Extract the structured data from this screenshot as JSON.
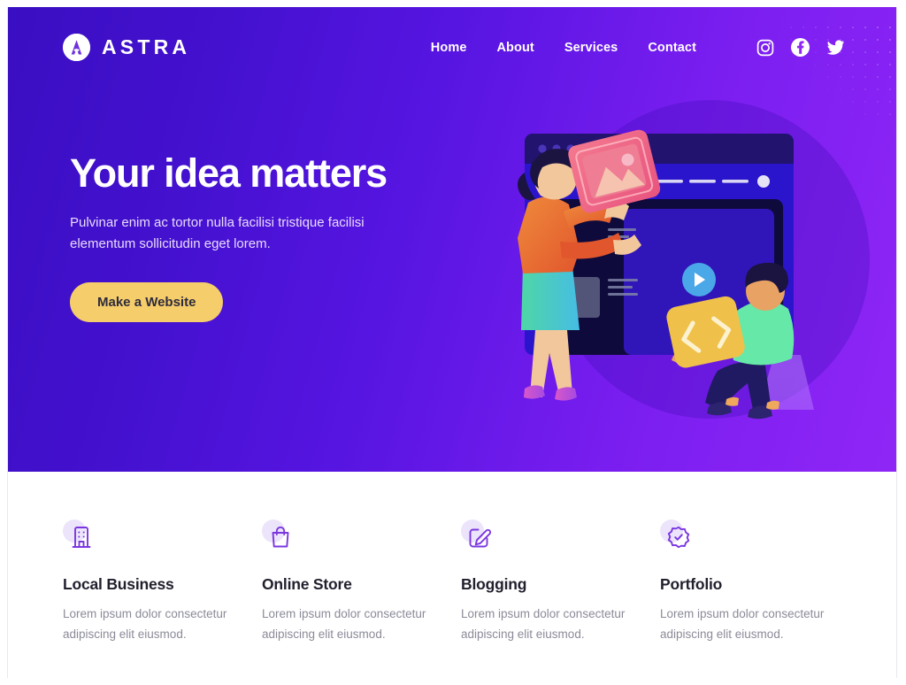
{
  "brand": {
    "name": "ASTRA",
    "logo_icon": "astra-a-mark-icon"
  },
  "header": {
    "nav": [
      {
        "label": "Home",
        "name": "nav-link-home"
      },
      {
        "label": "About",
        "name": "nav-link-about"
      },
      {
        "label": "Services",
        "name": "nav-link-services"
      },
      {
        "label": "Contact",
        "name": "nav-link-contact"
      }
    ],
    "social": [
      {
        "label": "Instagram",
        "icon": "instagram-icon"
      },
      {
        "label": "Facebook",
        "icon": "facebook-icon"
      },
      {
        "label": "Twitter",
        "icon": "twitter-icon"
      }
    ]
  },
  "hero": {
    "title": "Your idea matters",
    "subtitle": "Pulvinar enim ac tortor nulla facilisi tristique facilisi elementum sollicitudin eget lorem.",
    "cta_label": "Make a Website",
    "cta_color": "#f5cd6a",
    "gradient_from": "#3a0ec2",
    "gradient_to": "#8f26f6",
    "illustration": {
      "name": "website-builder-illustration",
      "browser_dots": 3,
      "play_button_color": "#4ba8e8",
      "pill_color": "#3fd9a0",
      "card_pink_color": "#f2608b",
      "card_yellow_color": "#efc14a",
      "code_symbol": "</>"
    }
  },
  "features": [
    {
      "title": "Local Business",
      "text": "Lorem ipsum dolor consectetur adipiscing elit eiusmod.",
      "icon": "building-icon"
    },
    {
      "title": "Online Store",
      "text": "Lorem ipsum dolor consectetur adipiscing elit eiusmod.",
      "icon": "shopping-bag-icon"
    },
    {
      "title": "Blogging",
      "text": "Lorem ipsum dolor consectetur adipiscing elit eiusmod.",
      "icon": "edit-square-icon"
    },
    {
      "title": "Portfolio",
      "text": "Lorem ipsum dolor consectetur adipiscing elit eiusmod.",
      "icon": "verified-badge-icon"
    }
  ],
  "theme": {
    "accent_purple": "#7b2ff7",
    "icon_purple": "#7b36e0",
    "icon_blob": "#ece4fb",
    "title_dark": "#23202e",
    "body_gray": "#8b8b99"
  }
}
